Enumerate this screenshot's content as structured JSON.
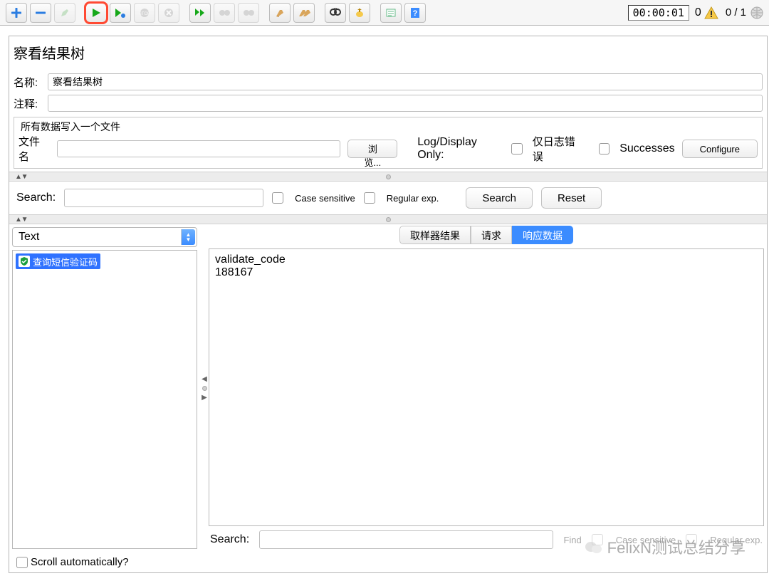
{
  "toolbar": {
    "time": "00:00:01",
    "warn_count": "0",
    "threads": "0 / 1"
  },
  "panel": {
    "title": "察看结果树",
    "name_label": "名称:",
    "name_value": "察看结果树",
    "comment_label": "注释:",
    "comment_value": ""
  },
  "file_group": {
    "title": "所有数据写入一个文件",
    "filename_label": "文件名",
    "filename_value": "",
    "browse": "浏览...",
    "log_only_label": "Log/Display Only:",
    "errors_only": "仅日志错误",
    "successes": "Successes",
    "configure": "Configure"
  },
  "search": {
    "label": "Search:",
    "value": "",
    "case_sensitive": "Case sensitive",
    "regex": "Regular exp.",
    "search_btn": "Search",
    "reset_btn": "Reset"
  },
  "left": {
    "dropdown_value": "Text",
    "tree_item": "查询短信验证码"
  },
  "tabs": {
    "sampler": "取样器结果",
    "request": "请求",
    "response": "响应数据"
  },
  "response_body": "validate_code\n188167",
  "bottom_search": {
    "label": "Search:",
    "value": "",
    "find": "Find",
    "case_sensitive": "Case sensitive",
    "regex": "Regular exp."
  },
  "scroll_auto": "Scroll automatically?",
  "watermark": "FelixN测试总结分享"
}
